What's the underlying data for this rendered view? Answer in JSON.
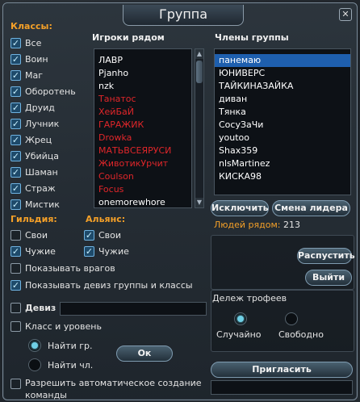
{
  "window": {
    "title": "Группа",
    "close_symbol": "✕"
  },
  "classes": {
    "header": "Классы:",
    "items": [
      {
        "label": "Все",
        "checked": true
      },
      {
        "label": "Воин",
        "checked": true
      },
      {
        "label": "Маг",
        "checked": true
      },
      {
        "label": "Оборотень",
        "checked": true
      },
      {
        "label": "Друид",
        "checked": true
      },
      {
        "label": "Лучник",
        "checked": true
      },
      {
        "label": "Жрец",
        "checked": true
      },
      {
        "label": "Убийца",
        "checked": true
      },
      {
        "label": "Шаман",
        "checked": true
      },
      {
        "label": "Страж",
        "checked": true
      },
      {
        "label": "Мистик",
        "checked": true
      }
    ]
  },
  "guild": {
    "header": "Гильдия:",
    "own": "Свои",
    "own_checked": false,
    "foreign": "Чужие",
    "foreign_checked": true
  },
  "alliance": {
    "header": "Альянс:",
    "own": "Свои",
    "own_checked": true,
    "foreign": "Чужие",
    "foreign_checked": true
  },
  "show_enemies": {
    "label": "Показывать врагов",
    "checked": false
  },
  "show_motto": {
    "label": "Показывать девиз группы и классы",
    "checked": true
  },
  "motto": {
    "label": "Девиз",
    "checked": false,
    "value": ""
  },
  "class_level": {
    "label": "Класс и уровень",
    "checked": false
  },
  "find_group": "Найти гр.",
  "find_member": "Найти чл.",
  "ok_button": "Ок",
  "allow_auto": {
    "label": "Разрешить автоматическое создание команды",
    "checked": false
  },
  "players_nearby": {
    "header": "Игроки рядом",
    "items": [
      {
        "name": "ЛАВР",
        "color": "#ffffff"
      },
      {
        "name": "Pjanho",
        "color": "#ffffff"
      },
      {
        "name": "nzk",
        "color": "#ffffff"
      },
      {
        "name": "Танатос",
        "color": "#e0262a"
      },
      {
        "name": "ХейБаЙ",
        "color": "#e0262a"
      },
      {
        "name": "ГАРАЖИК",
        "color": "#e0262a"
      },
      {
        "name": "Drowka",
        "color": "#e0262a"
      },
      {
        "name": "МАТЬВСЕЯРУСИ",
        "color": "#e0262a"
      },
      {
        "name": "ЖивотикУрчит",
        "color": "#e0262a"
      },
      {
        "name": "Coulson",
        "color": "#e0262a"
      },
      {
        "name": "Focus",
        "color": "#e0262a"
      },
      {
        "name": "onemorewhore",
        "color": "#ffffff"
      }
    ],
    "scroll_up": "▲",
    "scroll_down": "▼"
  },
  "members": {
    "header": "Члены группы",
    "items": [
      {
        "name": "панемаю",
        "selected": true
      },
      {
        "name": "ЮНИВЕРС",
        "selected": false
      },
      {
        "name": "ТАЙКИНАЗАЙКА",
        "selected": false
      },
      {
        "name": "диван",
        "selected": false
      },
      {
        "name": "Тянка",
        "selected": false
      },
      {
        "name": "СосуЗаЧи",
        "selected": false
      },
      {
        "name": "youtoo",
        "selected": false
      },
      {
        "name": "Shax359",
        "selected": false
      },
      {
        "name": "nlsMartinez",
        "selected": false
      },
      {
        "name": "КИСКА98",
        "selected": false
      }
    ]
  },
  "exclude_button": "Исключить",
  "change_leader_button": "Смена лидера",
  "people_nearby": {
    "label": "Людей рядом:",
    "value": "213"
  },
  "disband_button": "Распустить",
  "leave_button": "Выйти",
  "loot": {
    "header": "Дележ трофеев",
    "random": "Случайно",
    "free": "Свободно",
    "selected": "random"
  },
  "invite_button": "Пригласить",
  "invite_input": {
    "value": ""
  },
  "colors": {
    "accent": "#f4a028",
    "enemy": "#e0262a",
    "selection": "#1e5fae"
  }
}
